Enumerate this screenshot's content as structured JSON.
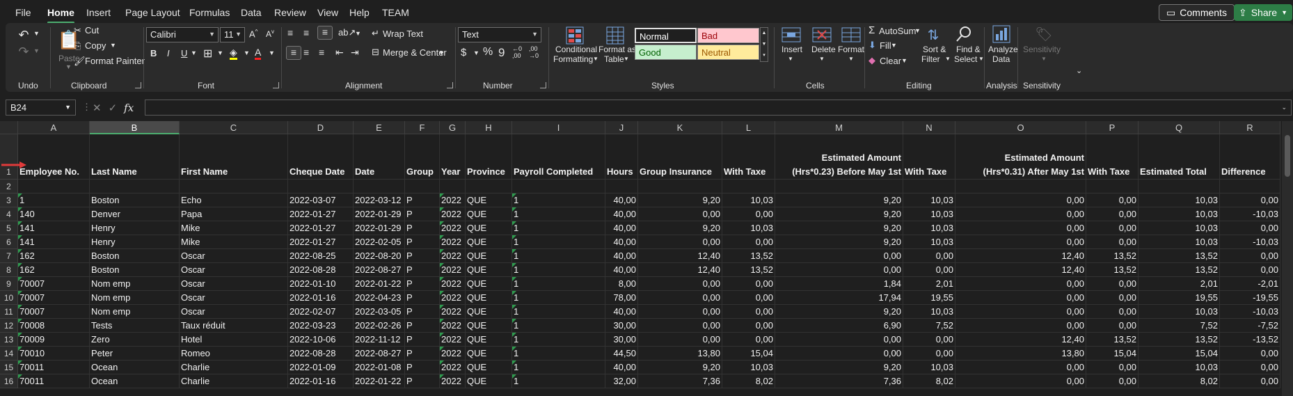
{
  "menu": {
    "items": [
      "File",
      "Home",
      "Insert",
      "Page Layout",
      "Formulas",
      "Data",
      "Review",
      "View",
      "Help",
      "TEAM"
    ],
    "comments": "Comments",
    "share": "Share"
  },
  "ribbon": {
    "undo": {
      "label": "Undo"
    },
    "clipboard": {
      "paste": "Paste",
      "cut": "Cut",
      "copy": "Copy",
      "format_painter": "Format Painter",
      "label": "Clipboard"
    },
    "font": {
      "name": "Calibri",
      "size": "11",
      "label": "Font"
    },
    "alignment": {
      "wrap_text": "Wrap Text",
      "merge_center": "Merge & Center",
      "label": "Alignment"
    },
    "number": {
      "format": "Text",
      "label": "Number"
    },
    "styles": {
      "conditional_formatting_1": "Conditional",
      "conditional_formatting_2": "Formatting",
      "format_as_table_1": "Format as",
      "format_as_table_2": "Table",
      "normal": "Normal",
      "bad": "Bad",
      "good": "Good",
      "neutral": "Neutral",
      "label": "Styles"
    },
    "cells": {
      "insert": "Insert",
      "delete": "Delete",
      "format": "Format",
      "label": "Cells"
    },
    "editing": {
      "autosum": "AutoSum",
      "fill": "Fill",
      "clear": "Clear",
      "sort_filter_1": "Sort &",
      "sort_filter_2": "Filter",
      "find_select_1": "Find &",
      "find_select_2": "Select",
      "label": "Editing"
    },
    "analysis": {
      "analyze_1": "Analyze",
      "analyze_2": "Data",
      "label": "Analysis"
    },
    "sensitivity": {
      "button": "Sensitivity",
      "label": "Sensitivity"
    }
  },
  "formula_bar": {
    "name_box": "B24",
    "fx": "fx",
    "value": ""
  },
  "sheet": {
    "columns": [
      "A",
      "B",
      "C",
      "D",
      "E",
      "F",
      "G",
      "H",
      "I",
      "J",
      "K",
      "L",
      "M",
      "N",
      "O",
      "P",
      "Q",
      "R"
    ],
    "selected_column": "B",
    "header_row": [
      [
        "Employee No."
      ],
      [
        "Last Name"
      ],
      [
        "First Name"
      ],
      [
        "Cheque Date"
      ],
      [
        "Date"
      ],
      [
        "Group"
      ],
      [
        "Year"
      ],
      [
        "Province"
      ],
      [
        "Payroll Completed"
      ],
      [
        "Hours"
      ],
      [
        "Group Insurance"
      ],
      [
        "With Taxe"
      ],
      [
        "Estimated Amount",
        "(Hrs*0.23) Before May 1st"
      ],
      [
        "With Taxe"
      ],
      [
        "Estimated Amount",
        "(Hrs*0.31) After May 1st"
      ],
      [
        "With Taxe"
      ],
      [
        "Estimated Total"
      ],
      [
        "Difference"
      ]
    ],
    "row_numbers": [
      "1",
      "2",
      "3",
      "4",
      "5",
      "6",
      "7",
      "8",
      "9",
      "10",
      "11",
      "12",
      "13",
      "14",
      "15",
      "16"
    ],
    "rows": [
      [
        "1",
        "Boston",
        "Echo",
        "2022-03-07",
        "2022-03-12",
        "P",
        "2022",
        "QUE",
        "1",
        "40,00",
        "9,20",
        "10,03",
        "9,20",
        "10,03",
        "0,00",
        "0,00",
        "10,03",
        "0,00"
      ],
      [
        "140",
        "Denver",
        "Papa",
        "2022-01-27",
        "2022-01-29",
        "P",
        "2022",
        "QUE",
        "1",
        "40,00",
        "0,00",
        "0,00",
        "9,20",
        "10,03",
        "0,00",
        "0,00",
        "10,03",
        "-10,03"
      ],
      [
        "141",
        "Henry",
        "Mike",
        "2022-01-27",
        "2022-01-29",
        "P",
        "2022",
        "QUE",
        "1",
        "40,00",
        "9,20",
        "10,03",
        "9,20",
        "10,03",
        "0,00",
        "0,00",
        "10,03",
        "0,00"
      ],
      [
        "141",
        "Henry",
        "Mike",
        "2022-01-27",
        "2022-02-05",
        "P",
        "2022",
        "QUE",
        "1",
        "40,00",
        "0,00",
        "0,00",
        "9,20",
        "10,03",
        "0,00",
        "0,00",
        "10,03",
        "-10,03"
      ],
      [
        "162",
        "Boston",
        "Oscar",
        "2022-08-25",
        "2022-08-20",
        "P",
        "2022",
        "QUE",
        "1",
        "40,00",
        "12,40",
        "13,52",
        "0,00",
        "0,00",
        "12,40",
        "13,52",
        "13,52",
        "0,00"
      ],
      [
        "162",
        "Boston",
        "Oscar",
        "2022-08-28",
        "2022-08-27",
        "P",
        "2022",
        "QUE",
        "1",
        "40,00",
        "12,40",
        "13,52",
        "0,00",
        "0,00",
        "12,40",
        "13,52",
        "13,52",
        "0,00"
      ],
      [
        "70007",
        "Nom emp",
        "Oscar",
        "2022-01-10",
        "2022-01-22",
        "P",
        "2022",
        "QUE",
        "1",
        "8,00",
        "0,00",
        "0,00",
        "1,84",
        "2,01",
        "0,00",
        "0,00",
        "2,01",
        "-2,01"
      ],
      [
        "70007",
        "Nom emp",
        "Oscar",
        "2022-01-16",
        "2022-04-23",
        "P",
        "2022",
        "QUE",
        "1",
        "78,00",
        "0,00",
        "0,00",
        "17,94",
        "19,55",
        "0,00",
        "0,00",
        "19,55",
        "-19,55"
      ],
      [
        "70007",
        "Nom emp",
        "Oscar",
        "2022-02-07",
        "2022-03-05",
        "P",
        "2022",
        "QUE",
        "1",
        "40,00",
        "0,00",
        "0,00",
        "9,20",
        "10,03",
        "0,00",
        "0,00",
        "10,03",
        "-10,03"
      ],
      [
        "70008",
        "Tests",
        "Taux réduit",
        "2022-03-23",
        "2022-02-26",
        "P",
        "2022",
        "QUE",
        "1",
        "30,00",
        "0,00",
        "0,00",
        "6,90",
        "7,52",
        "0,00",
        "0,00",
        "7,52",
        "-7,52"
      ],
      [
        "70009",
        "Zero",
        "Hotel",
        "2022-10-06",
        "2022-11-12",
        "P",
        "2022",
        "QUE",
        "1",
        "30,00",
        "0,00",
        "0,00",
        "0,00",
        "0,00",
        "12,40",
        "13,52",
        "13,52",
        "-13,52"
      ],
      [
        "70010",
        "Peter",
        "Romeo",
        "2022-08-28",
        "2022-08-27",
        "P",
        "2022",
        "QUE",
        "1",
        "44,50",
        "13,80",
        "15,04",
        "0,00",
        "0,00",
        "13,80",
        "15,04",
        "15,04",
        "0,00"
      ],
      [
        "70011",
        "Ocean",
        "Charlie",
        "2022-01-09",
        "2022-01-08",
        "P",
        "2022",
        "QUE",
        "1",
        "40,00",
        "9,20",
        "10,03",
        "9,20",
        "10,03",
        "0,00",
        "0,00",
        "10,03",
        "0,00"
      ],
      [
        "70011",
        "Ocean",
        "Charlie",
        "2022-01-16",
        "2022-01-22",
        "P",
        "2022",
        "QUE",
        "1",
        "32,00",
        "7,36",
        "8,02",
        "7,36",
        "8,02",
        "0,00",
        "0,00",
        "8,02",
        "0,00"
      ]
    ]
  },
  "colors": {
    "accent": "#4cae6f",
    "share": "#2d7d46",
    "bad_bg": "#ffc7ce",
    "bad_fg": "#9c0006",
    "good_bg": "#c6efce",
    "good_fg": "#006100",
    "neutral_bg": "#ffeb9c",
    "neutral_fg": "#9c5700",
    "arrow": "#e03a3a"
  }
}
